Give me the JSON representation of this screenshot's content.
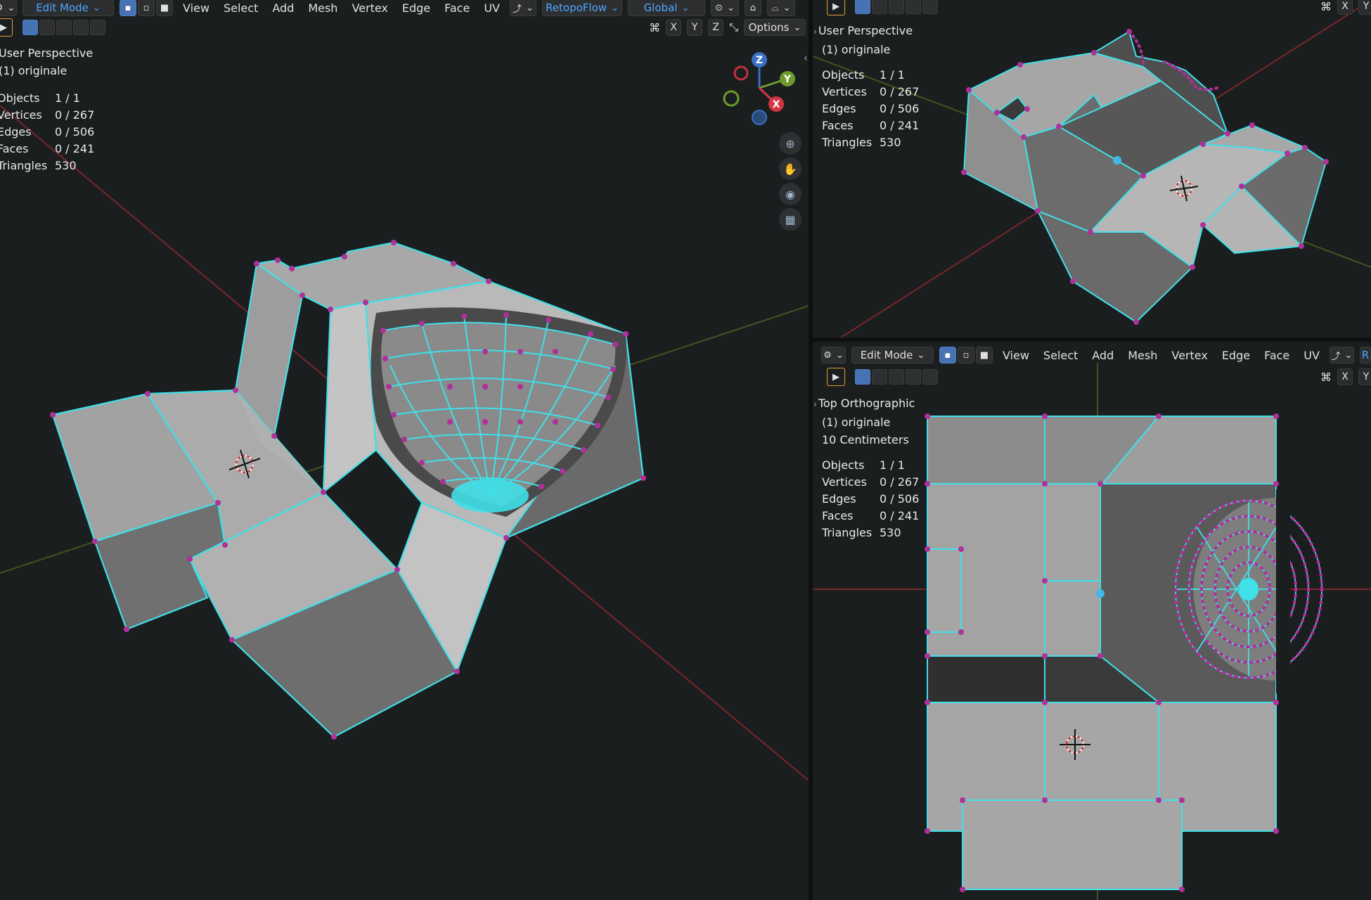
{
  "left_viewport": {
    "header": {
      "mode": "Edit Mode",
      "menus": [
        "View",
        "Select",
        "Add",
        "Mesh",
        "Vertex",
        "Edge",
        "Face",
        "UV"
      ],
      "addon": "RetopoFlow",
      "orientation": "Global",
      "options": "Options",
      "axes": [
        "X",
        "Y",
        "Z"
      ]
    },
    "view_name": "User Perspective",
    "object_name": "(1) originale",
    "stats": {
      "objects_label": "Objects",
      "objects": "1 / 1",
      "vertices_label": "Vertices",
      "vertices": "0 / 267",
      "edges_label": "Edges",
      "edges": "0 / 506",
      "faces_label": "Faces",
      "faces": "0 / 241",
      "triangles_label": "Triangles",
      "triangles": "530"
    },
    "gizmo": {
      "z": "Z",
      "y": "Y",
      "x": "X"
    }
  },
  "top_right_viewport": {
    "axes": [
      "X",
      "Y"
    ],
    "view_name": "User Perspective",
    "object_name": "(1) originale",
    "stats": {
      "objects_label": "Objects",
      "objects": "1 / 1",
      "vertices_label": "Vertices",
      "vertices": "0 / 267",
      "edges_label": "Edges",
      "edges": "0 / 506",
      "faces_label": "Faces",
      "faces": "0 / 241",
      "triangles_label": "Triangles",
      "triangles": "530"
    }
  },
  "bottom_right_viewport": {
    "header": {
      "mode": "Edit Mode",
      "menus": [
        "View",
        "Select",
        "Add",
        "Mesh",
        "Vertex",
        "Edge",
        "Face",
        "UV"
      ],
      "axes": [
        "X",
        "Y"
      ]
    },
    "view_name": "Top Orthographic",
    "object_name": "(1) originale",
    "scale": "10 Centimeters",
    "stats": {
      "objects_label": "Objects",
      "objects": "1 / 1",
      "vertices_label": "Vertices",
      "vertices": "0 / 267",
      "edges_label": "Edges",
      "edges": "0 / 506",
      "faces_label": "Faces",
      "faces": "0 / 241",
      "triangles_label": "Triangles",
      "triangles": "530"
    }
  },
  "colors": {
    "background": "#1b1e1f",
    "edge": "#3fe0e8",
    "vertex": "#b0309a",
    "face_light": "#b4b4b4",
    "face_dark": "#5e5e5e",
    "x_axis": "#8a2a2e",
    "y_axis": "#4a5a20",
    "accent": "#4fa7ff"
  }
}
